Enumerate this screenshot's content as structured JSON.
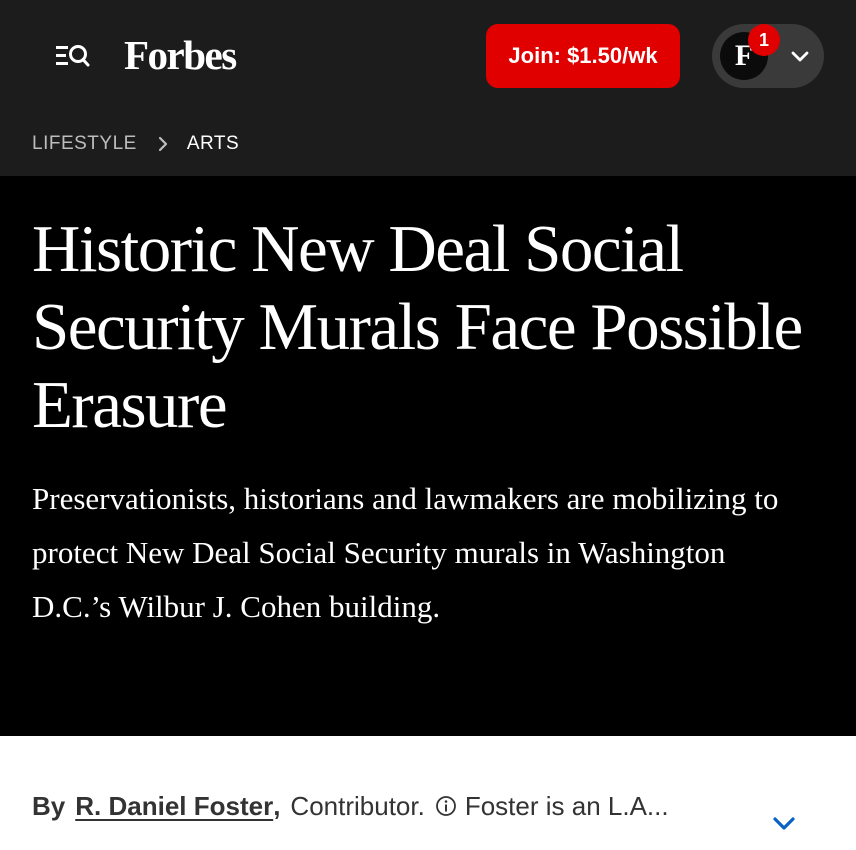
{
  "header": {
    "logo_text": "Forbes",
    "join_label": "Join: $1.50/wk",
    "account": {
      "avatar_letter": "F",
      "notification_count": "1"
    },
    "menu_icon": "menu-search-icon",
    "account_chevron_icon": "chevron-down-icon"
  },
  "breadcrumb": {
    "items": [
      "LIFESTYLE",
      "ARTS"
    ],
    "separator_icon": "chevron-right-icon"
  },
  "article": {
    "headline": "Historic New Deal Social Security Murals Face Possible Erasure",
    "dek": "Preservationists, historians and lawmakers are mobilizing to protect New Deal Social Security murals in Washington D.C.’s Wilbur J. Cohen building."
  },
  "byline": {
    "by_label": "By",
    "author": "R. Daniel Foster",
    "comma": ",",
    "role": "Contributor.",
    "info_icon": "info-icon",
    "bio": "Foster is an L.A...",
    "expand_icon": "chevron-down-icon"
  },
  "colors": {
    "header_bg": "#1c1c1c",
    "hero_bg": "#000000",
    "join_button": "#e00000",
    "notification_badge": "#e00000",
    "expand_chevron": "#0a62c4",
    "body_text": "#333333"
  }
}
